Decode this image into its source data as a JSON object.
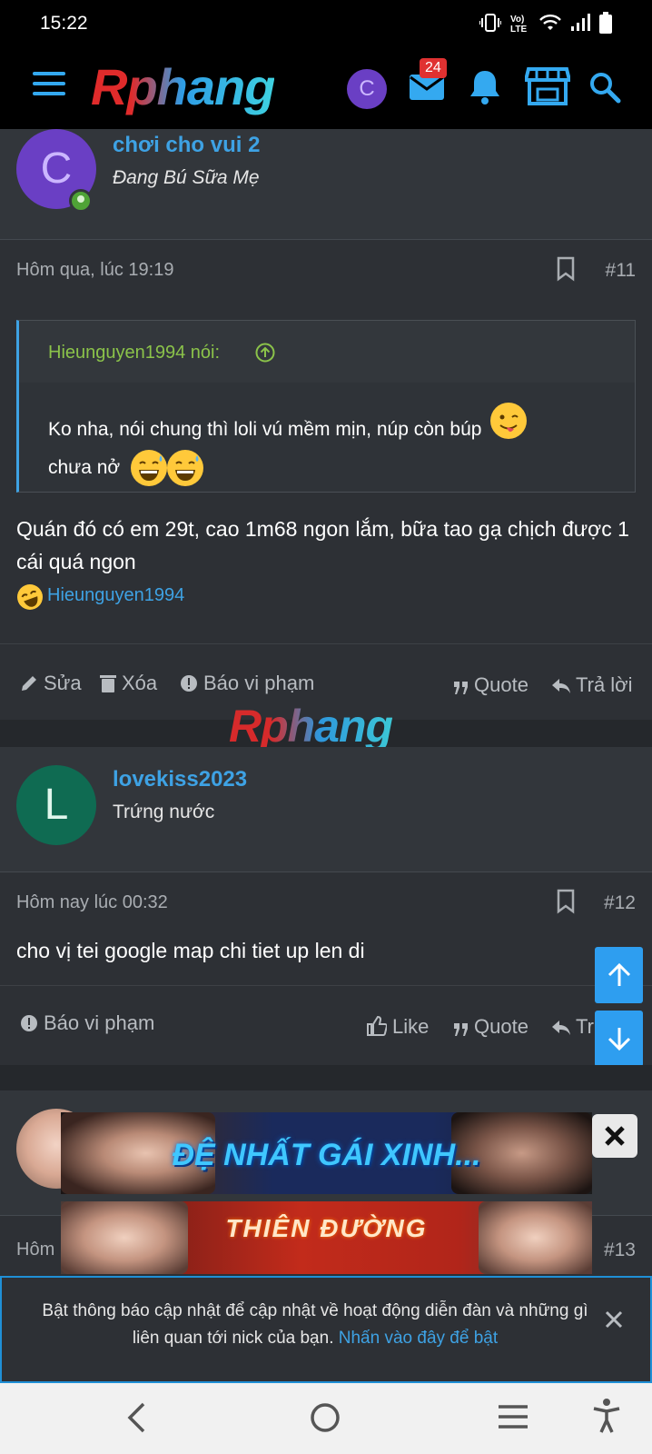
{
  "status_bar": {
    "time": "15:22",
    "icons": [
      "vibrate-icon",
      "volte-icon",
      "wifi-icon",
      "signal-icon",
      "battery-icon"
    ]
  },
  "nav": {
    "logo": "Rphang",
    "avatar_letter": "C",
    "notification_count": "24",
    "icons": [
      "menu-icon",
      "mail-icon",
      "bell-icon",
      "shop-icon",
      "search-icon"
    ]
  },
  "posts": [
    {
      "avatar_letter": "C",
      "avatar_color": "#6a3fc4",
      "username": "chơi cho vui 2",
      "user_title": "Đang Bú Sữa Mẹ",
      "date": "Hôm qua, lúc 19:19",
      "number": "#11",
      "quote": {
        "author": "Hieunguyen1994 nói:",
        "line1": "Ko nha, nói chung thì loli vú mềm mịn, núp còn búp",
        "line2": "chưa nở"
      },
      "text": "Quán đó có em 29t, cao 1m68 ngon lắm, bữa tao gạ chịch được 1 cái quá ngon",
      "reaction_user": "Hieunguyen1994",
      "actions": {
        "edit": "Sửa",
        "delete": "Xóa",
        "report": "Báo vi phạm",
        "quote": "Quote",
        "reply": "Trả lời"
      }
    },
    {
      "avatar_letter": "L",
      "avatar_color": "#0f6b52",
      "username": "lovekiss2023",
      "user_title": "Trứng nước",
      "date": "Hôm nay lúc 00:32",
      "number": "#12",
      "text": "cho vị tei google map chi tiet up len di",
      "actions": {
        "report": "Báo vi phạm",
        "like": "Like",
        "quote": "Quote",
        "reply": "Tr"
      }
    },
    {
      "date": "Hôm",
      "number": "#13"
    }
  ],
  "watermark": "Rphang",
  "ads": [
    {
      "text": "ĐỆ NHẤT GÁI XINH..."
    },
    {
      "text": "THIÊN ĐƯỜNG"
    }
  ],
  "notification": {
    "text": "Bật thông báo cập nhật để cập nhật về hoạt động diễn đàn và những gì liên quan tới nick của bạn.",
    "link": "Nhấn vào đây để bật"
  },
  "colors": {
    "accent": "#3ea2e4",
    "quote_author": "#8bc34a",
    "background": "#25282c",
    "panel": "#2d3035"
  }
}
